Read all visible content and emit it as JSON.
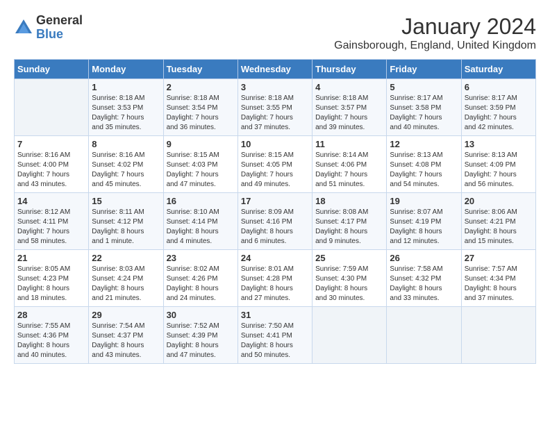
{
  "logo": {
    "general": "General",
    "blue": "Blue"
  },
  "title": "January 2024",
  "location": "Gainsborough, England, United Kingdom",
  "days_of_week": [
    "Sunday",
    "Monday",
    "Tuesday",
    "Wednesday",
    "Thursday",
    "Friday",
    "Saturday"
  ],
  "weeks": [
    [
      {
        "day": "",
        "info": ""
      },
      {
        "day": "1",
        "info": "Sunrise: 8:18 AM\nSunset: 3:53 PM\nDaylight: 7 hours\nand 35 minutes."
      },
      {
        "day": "2",
        "info": "Sunrise: 8:18 AM\nSunset: 3:54 PM\nDaylight: 7 hours\nand 36 minutes."
      },
      {
        "day": "3",
        "info": "Sunrise: 8:18 AM\nSunset: 3:55 PM\nDaylight: 7 hours\nand 37 minutes."
      },
      {
        "day": "4",
        "info": "Sunrise: 8:18 AM\nSunset: 3:57 PM\nDaylight: 7 hours\nand 39 minutes."
      },
      {
        "day": "5",
        "info": "Sunrise: 8:17 AM\nSunset: 3:58 PM\nDaylight: 7 hours\nand 40 minutes."
      },
      {
        "day": "6",
        "info": "Sunrise: 8:17 AM\nSunset: 3:59 PM\nDaylight: 7 hours\nand 42 minutes."
      }
    ],
    [
      {
        "day": "7",
        "info": "Sunrise: 8:16 AM\nSunset: 4:00 PM\nDaylight: 7 hours\nand 43 minutes."
      },
      {
        "day": "8",
        "info": "Sunrise: 8:16 AM\nSunset: 4:02 PM\nDaylight: 7 hours\nand 45 minutes."
      },
      {
        "day": "9",
        "info": "Sunrise: 8:15 AM\nSunset: 4:03 PM\nDaylight: 7 hours\nand 47 minutes."
      },
      {
        "day": "10",
        "info": "Sunrise: 8:15 AM\nSunset: 4:05 PM\nDaylight: 7 hours\nand 49 minutes."
      },
      {
        "day": "11",
        "info": "Sunrise: 8:14 AM\nSunset: 4:06 PM\nDaylight: 7 hours\nand 51 minutes."
      },
      {
        "day": "12",
        "info": "Sunrise: 8:13 AM\nSunset: 4:08 PM\nDaylight: 7 hours\nand 54 minutes."
      },
      {
        "day": "13",
        "info": "Sunrise: 8:13 AM\nSunset: 4:09 PM\nDaylight: 7 hours\nand 56 minutes."
      }
    ],
    [
      {
        "day": "14",
        "info": "Sunrise: 8:12 AM\nSunset: 4:11 PM\nDaylight: 7 hours\nand 58 minutes."
      },
      {
        "day": "15",
        "info": "Sunrise: 8:11 AM\nSunset: 4:12 PM\nDaylight: 8 hours\nand 1 minute."
      },
      {
        "day": "16",
        "info": "Sunrise: 8:10 AM\nSunset: 4:14 PM\nDaylight: 8 hours\nand 4 minutes."
      },
      {
        "day": "17",
        "info": "Sunrise: 8:09 AM\nSunset: 4:16 PM\nDaylight: 8 hours\nand 6 minutes."
      },
      {
        "day": "18",
        "info": "Sunrise: 8:08 AM\nSunset: 4:17 PM\nDaylight: 8 hours\nand 9 minutes."
      },
      {
        "day": "19",
        "info": "Sunrise: 8:07 AM\nSunset: 4:19 PM\nDaylight: 8 hours\nand 12 minutes."
      },
      {
        "day": "20",
        "info": "Sunrise: 8:06 AM\nSunset: 4:21 PM\nDaylight: 8 hours\nand 15 minutes."
      }
    ],
    [
      {
        "day": "21",
        "info": "Sunrise: 8:05 AM\nSunset: 4:23 PM\nDaylight: 8 hours\nand 18 minutes."
      },
      {
        "day": "22",
        "info": "Sunrise: 8:03 AM\nSunset: 4:24 PM\nDaylight: 8 hours\nand 21 minutes."
      },
      {
        "day": "23",
        "info": "Sunrise: 8:02 AM\nSunset: 4:26 PM\nDaylight: 8 hours\nand 24 minutes."
      },
      {
        "day": "24",
        "info": "Sunrise: 8:01 AM\nSunset: 4:28 PM\nDaylight: 8 hours\nand 27 minutes."
      },
      {
        "day": "25",
        "info": "Sunrise: 7:59 AM\nSunset: 4:30 PM\nDaylight: 8 hours\nand 30 minutes."
      },
      {
        "day": "26",
        "info": "Sunrise: 7:58 AM\nSunset: 4:32 PM\nDaylight: 8 hours\nand 33 minutes."
      },
      {
        "day": "27",
        "info": "Sunrise: 7:57 AM\nSunset: 4:34 PM\nDaylight: 8 hours\nand 37 minutes."
      }
    ],
    [
      {
        "day": "28",
        "info": "Sunrise: 7:55 AM\nSunset: 4:36 PM\nDaylight: 8 hours\nand 40 minutes."
      },
      {
        "day": "29",
        "info": "Sunrise: 7:54 AM\nSunset: 4:37 PM\nDaylight: 8 hours\nand 43 minutes."
      },
      {
        "day": "30",
        "info": "Sunrise: 7:52 AM\nSunset: 4:39 PM\nDaylight: 8 hours\nand 47 minutes."
      },
      {
        "day": "31",
        "info": "Sunrise: 7:50 AM\nSunset: 4:41 PM\nDaylight: 8 hours\nand 50 minutes."
      },
      {
        "day": "",
        "info": ""
      },
      {
        "day": "",
        "info": ""
      },
      {
        "day": "",
        "info": ""
      }
    ]
  ]
}
